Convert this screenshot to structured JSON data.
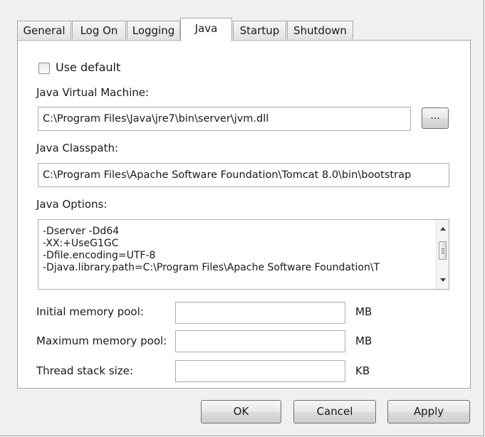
{
  "tabs": [
    {
      "label": "General"
    },
    {
      "label": "Log On"
    },
    {
      "label": "Logging"
    },
    {
      "label": "Java",
      "active": true
    },
    {
      "label": "Startup"
    },
    {
      "label": "Shutdown"
    }
  ],
  "use_default": {
    "label": "Use default",
    "checked": false
  },
  "jvm": {
    "label": "Java Virtual Machine:",
    "value": "C:\\Program Files\\Java\\jre7\\bin\\server\\jvm.dll",
    "browse_label": "..."
  },
  "classpath": {
    "label": "Java Classpath:",
    "value": "C:\\Program Files\\Apache Software Foundation\\Tomcat 8.0\\bin\\bootstrap"
  },
  "options": {
    "label": "Java Options:",
    "lines": [
      "-Dserver -Dd64",
      "-XX:+UseG1GC",
      "-Dfile.encoding=UTF-8",
      "-Djava.library.path=C:\\Program Files\\Apache Software Foundation\\T"
    ]
  },
  "memory": {
    "initial": {
      "label": "Initial memory pool:",
      "value": "",
      "unit": "MB"
    },
    "maximum": {
      "label": "Maximum memory pool:",
      "value": "",
      "unit": "MB"
    },
    "thread_stack": {
      "label": "Thread stack size:",
      "value": "",
      "unit": "KB"
    }
  },
  "buttons": {
    "ok": "OK",
    "cancel": "Cancel",
    "apply": "Apply"
  }
}
